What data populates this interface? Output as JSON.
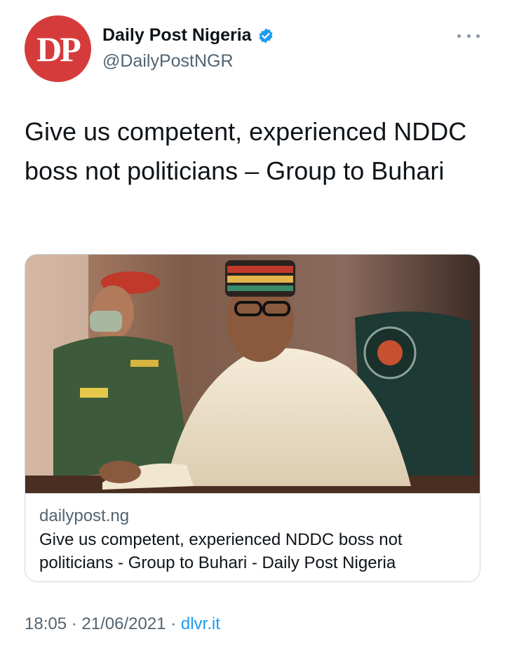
{
  "account": {
    "avatar_text": "DP",
    "display_name": "Daily Post Nigeria",
    "handle": "@DailyPostNGR",
    "verified_icon": "verified-badge-icon",
    "avatar_color": "#d63b3b",
    "verified_color": "#1d9bf0"
  },
  "tweet": {
    "text": "Give us competent, experienced NDDC boss not politicians – Group to Buhari"
  },
  "link_card": {
    "domain": "dailypost.ng",
    "title": "Give us competent, experienced NDDC boss not politicians - Group to Buhari - Daily Post Nigeria",
    "image_icon": "photo-icon"
  },
  "meta": {
    "time": "18:05",
    "separator": "·",
    "date": "21/06/2021",
    "source": "dlvr.it"
  },
  "more_icon": "more-options-icon"
}
